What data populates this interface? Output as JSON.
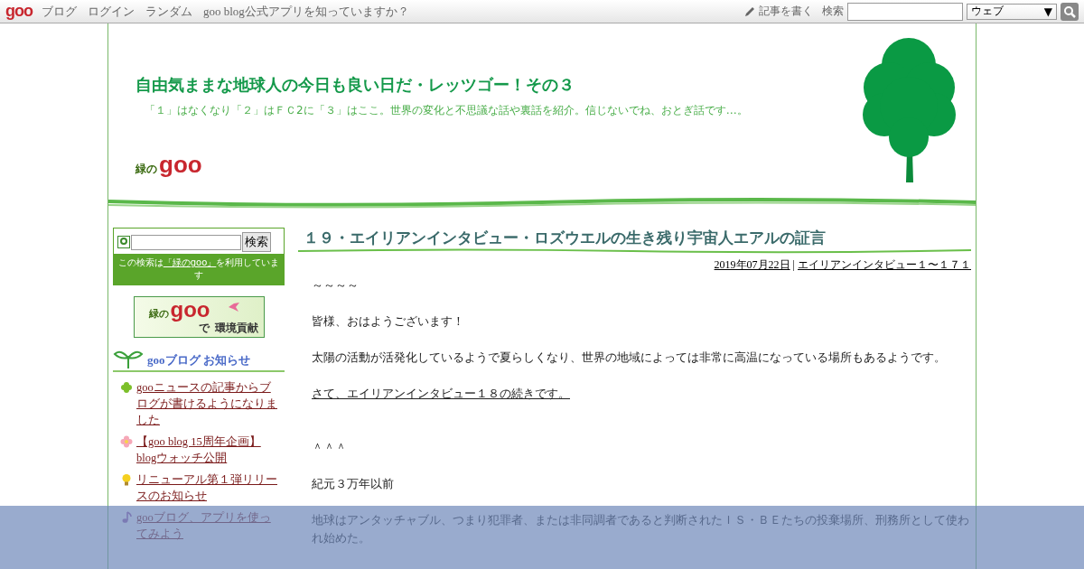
{
  "topbar": {
    "logo": "goo",
    "links": [
      "ブログ",
      "ログイン",
      "ランダム",
      "goo blog公式アプリを知っていますか？"
    ],
    "write_link": "記事を書く",
    "search_label": "検索",
    "search_select": "ウェブ",
    "search_select_arrow": "▼"
  },
  "header": {
    "title": "自由気ままな地球人の今日も良い日だ・レッツゴー！その３",
    "description": "「１」はなくなり「２」はＦＣ2に「３」はここ。世界の変化と不思議な話や裏話を紹介。信じないでね、おとぎ話です…。",
    "logo_prefix": "緑の",
    "logo": "goo"
  },
  "sidebar": {
    "search_button": "検索",
    "note_before": "この検索は",
    "note_link": "「緑のgoo」",
    "note_after": "を利用しています",
    "banner": {
      "prefix": "緑の",
      "logo": "goo",
      "suffix": "で",
      "tagline": "環境貢献"
    },
    "notices": {
      "heading": "gooブログ お知らせ",
      "items": [
        {
          "kind": "clover",
          "text": "gooニュースの記事からブログが書けるようになりました"
        },
        {
          "kind": "flower",
          "text": "【goo blog 15周年企画】blogウォッチ公開"
        },
        {
          "kind": "bulb",
          "text": "リニューアル第１弾リリースのお知らせ"
        },
        {
          "kind": "note",
          "text": "gooブログ、アプリを使ってみよう"
        }
      ]
    }
  },
  "post": {
    "title": "１９・エイリアンインタビュー・ロズウエルの生き残り宇宙人エアルの証言",
    "date": "2019年07月22日",
    "separator": "|",
    "category": "エイリアンインタビュー１〜１７１",
    "paragraphs": [
      {
        "kind": "text",
        "text": "～～～～"
      },
      {
        "kind": "text",
        "text": "皆様、おはようございます！"
      },
      {
        "kind": "text",
        "text": "太陽の活動が活発化しているようで夏らしくなり、世界の地域によっては非常に高温になっている場所もあるようです。"
      },
      {
        "kind": "link",
        "text": "さて、エイリアンインタビュー１８の続きです。"
      },
      {
        "kind": "text",
        "text": "＾＾＾"
      },
      {
        "kind": "text",
        "text": "紀元３万年以前"
      },
      {
        "kind": "text",
        "text": "地球はアンタッチャブル、つまり犯罪者、または非同調者であると判断されたＩＳ・ＢＥたちの投棄場所、刑務所として使われ始めた。"
      }
    ]
  }
}
